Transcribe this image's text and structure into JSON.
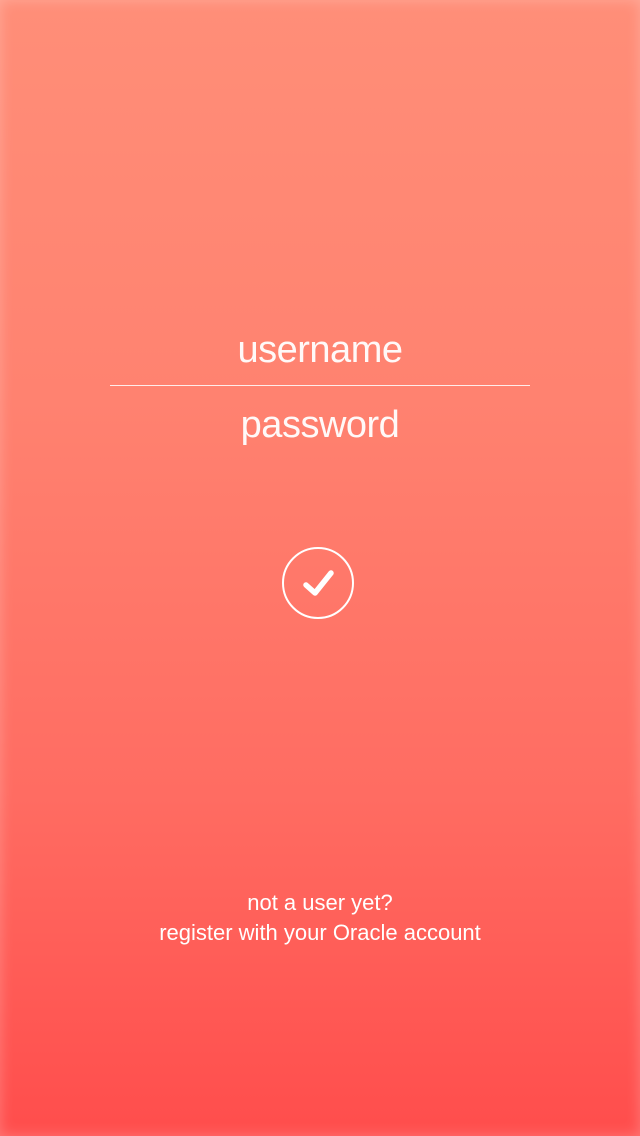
{
  "login": {
    "username_placeholder": "username",
    "password_placeholder": "password",
    "username_value": "",
    "password_value": "",
    "submit_icon": "checkmark-icon"
  },
  "footer": {
    "prompt": "not a user yet?",
    "register_link": "register with your Oracle account"
  },
  "colors": {
    "gradient_top": "#ff8e78",
    "gradient_bottom": "#ff4d4c",
    "foreground": "#ffffff"
  }
}
